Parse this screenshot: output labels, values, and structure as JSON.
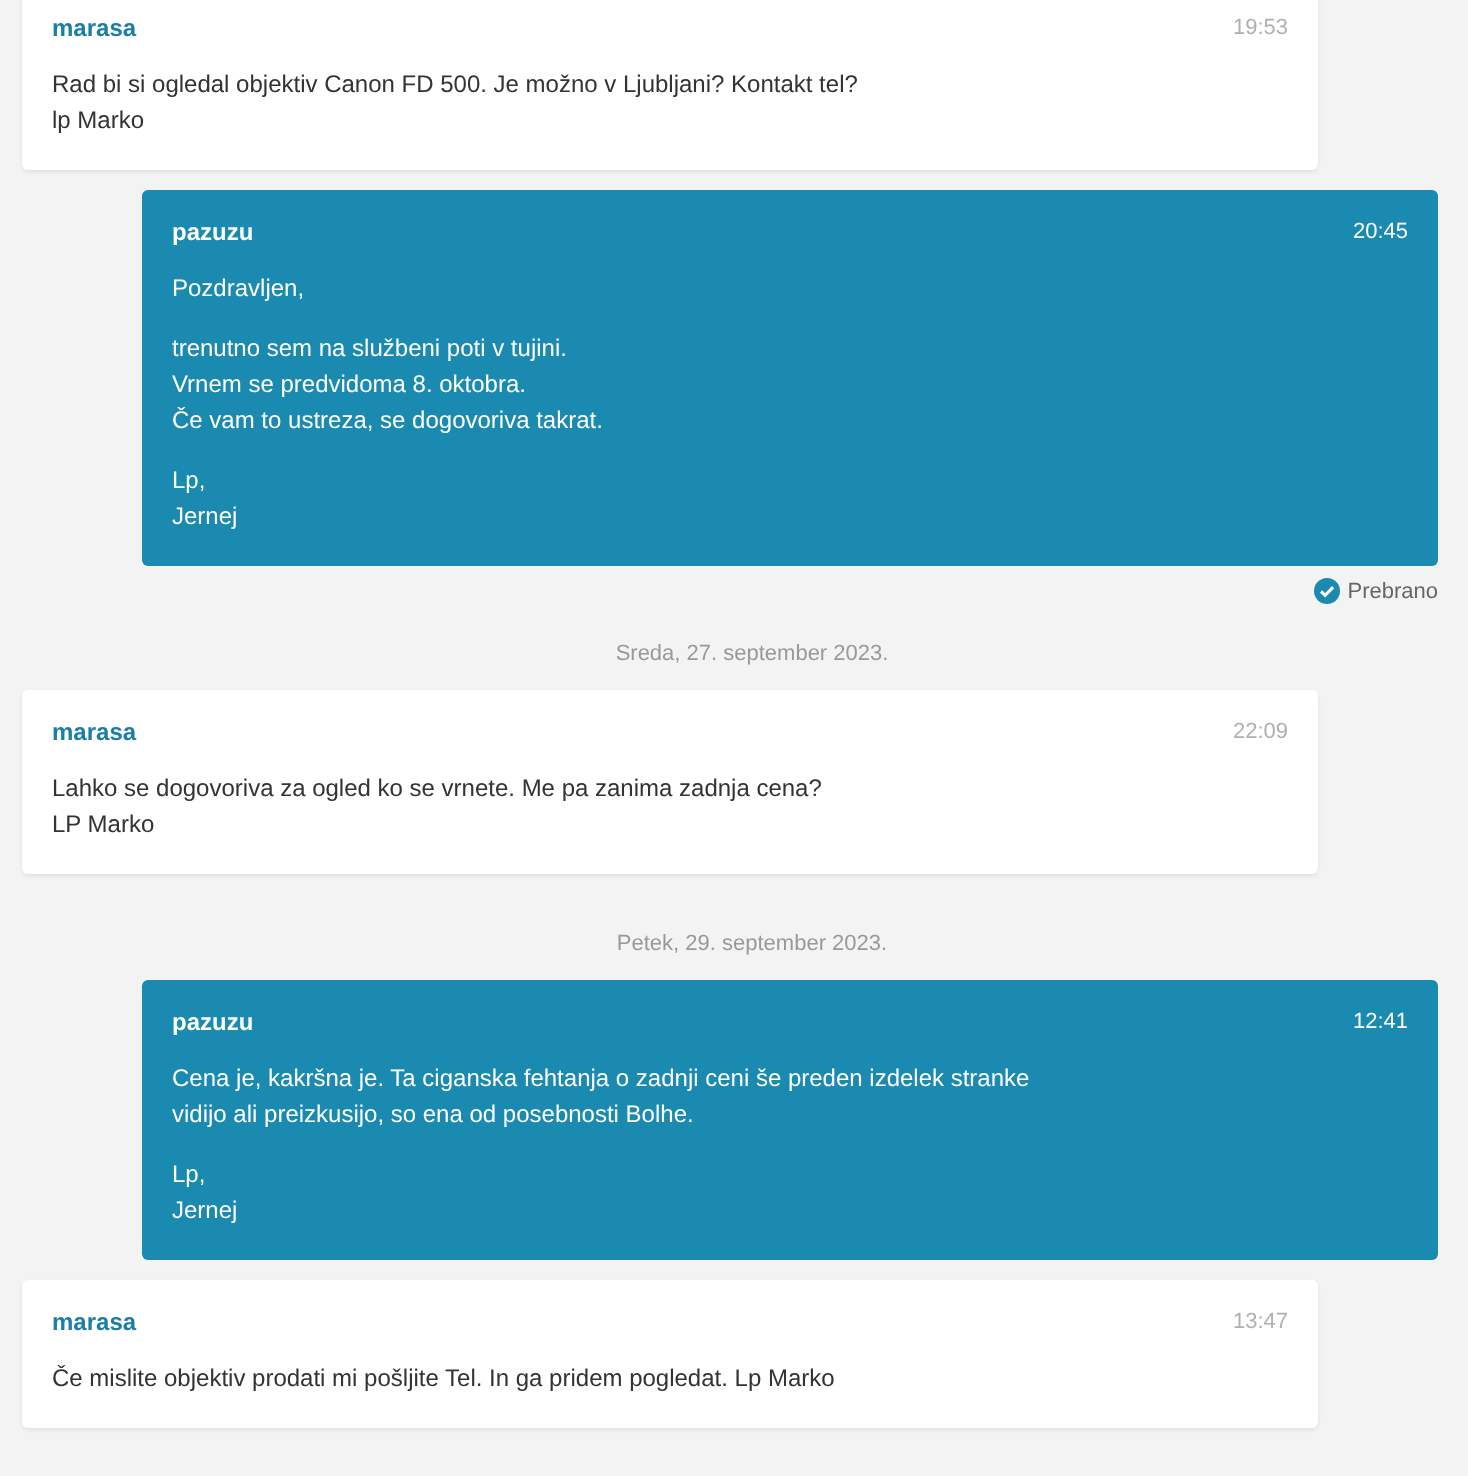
{
  "thread": [
    {
      "kind": "message",
      "outgoing": false,
      "author": "marasa",
      "time": "19:53",
      "paragraphs": [
        "Rad bi si ogledal objektiv Canon FD 500. Je možno v Ljubljani? Kontakt tel?\nlp Marko"
      ]
    },
    {
      "kind": "message",
      "outgoing": true,
      "author": "pazuzu",
      "time": "20:45",
      "paragraphs": [
        "Pozdravljen,",
        "trenutno sem na službeni poti v tujini.\nVrnem se predvidoma 8. oktobra.\nČe vam to ustreza, se dogovoriva takrat.",
        "Lp,\nJernej"
      ],
      "status": "Prebrano"
    },
    {
      "kind": "date",
      "text": "Sreda, 27. september 2023."
    },
    {
      "kind": "message",
      "outgoing": false,
      "author": "marasa",
      "time": "22:09",
      "paragraphs": [
        "Lahko se dogovoriva za ogled ko se vrnete. Me pa zanima zadnja cena?\nLP Marko"
      ]
    },
    {
      "kind": "date",
      "text": "Petek, 29. september 2023."
    },
    {
      "kind": "message",
      "outgoing": true,
      "author": "pazuzu",
      "time": "12:41",
      "paragraphs": [
        "Cena je, kakršna je. Ta ciganska fehtanja o zadnji ceni še preden izdelek stranke\nvidijo ali preizkusijo, so ena od posebnosti Bolhe.",
        "Lp,\nJernej"
      ]
    },
    {
      "kind": "message",
      "outgoing": false,
      "author": "marasa",
      "time": "13:47",
      "paragraphs": [
        "Če mislite objektiv prodati mi pošljite Tel. In ga pridem pogledat. Lp Marko"
      ]
    }
  ]
}
